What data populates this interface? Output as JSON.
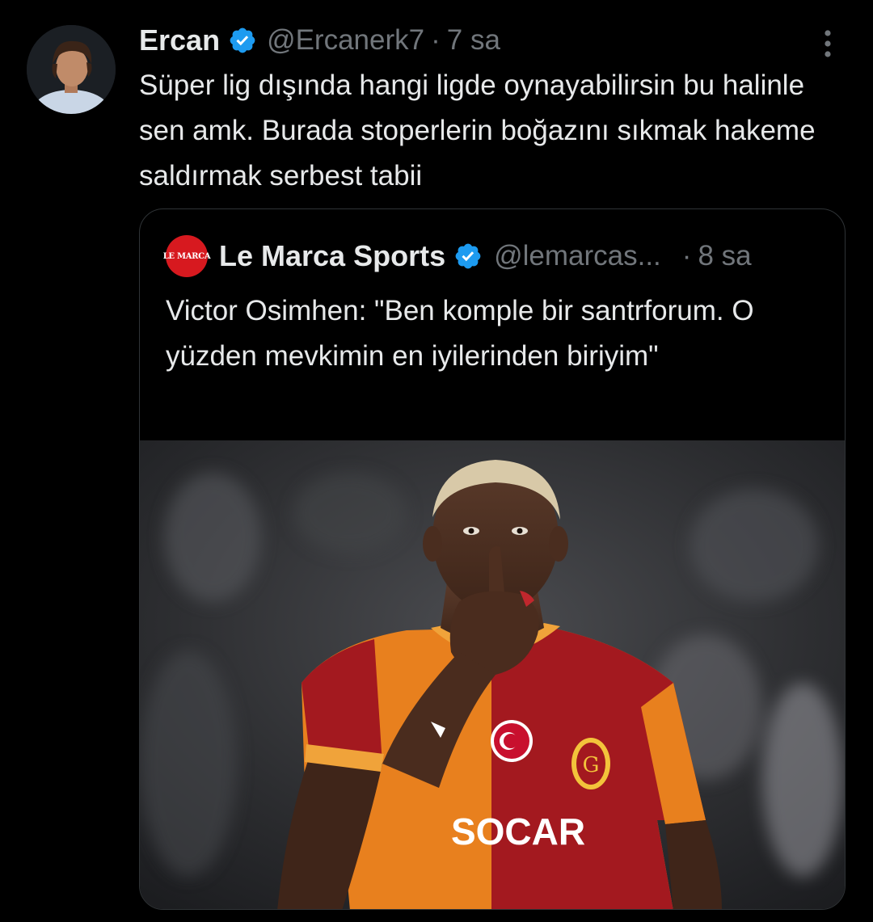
{
  "tweet": {
    "author": {
      "display_name": "Ercan",
      "handle": "@Ercanerk7",
      "verified": true
    },
    "separator": "·",
    "time": "7 sa",
    "text": "Süper lig dışında hangi ligde oynayabilirsin bu halinle sen amk. Burada stoperlerin boğazını sıkmak hakeme saldırmak serbest tabii",
    "more_icon": "ellipsis-vertical-icon"
  },
  "quoted_tweet": {
    "author": {
      "display_name": "Le Marca Sports",
      "handle": "@lemarcas...",
      "verified": true,
      "logo_text": "LE MARCA"
    },
    "separator": "·",
    "time": "8 sa",
    "text": "Victor Osimhen: \"Ben komple bir santrforum. O yüzden mevkimin en iyilerinden biriyim\"",
    "media": {
      "jersey_sponsor": "SOCAR"
    }
  },
  "colors": {
    "background": "#000000",
    "text_primary": "#e7e9ea",
    "text_secondary": "#71767b",
    "verified_blue": "#1d9bf0",
    "border": "#2f3336",
    "logo_red": "#d7191f"
  }
}
